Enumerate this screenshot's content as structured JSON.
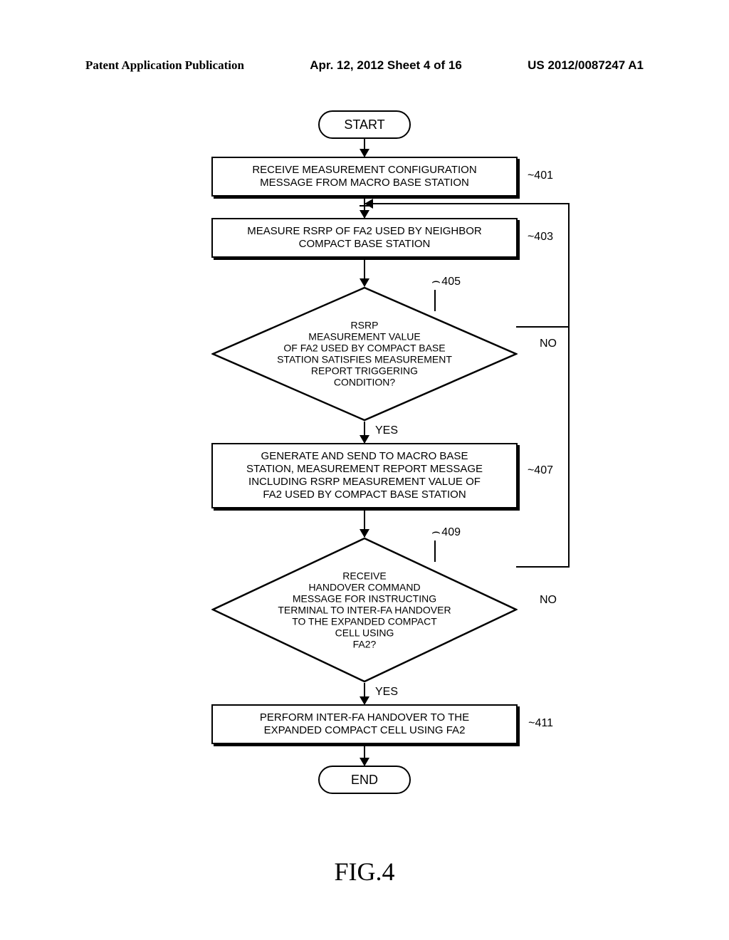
{
  "header": {
    "left": "Patent Application Publication",
    "center": "Apr. 12, 2012  Sheet 4 of 16",
    "right": "US 2012/0087247 A1"
  },
  "flowchart": {
    "start": "START",
    "step1": "RECEIVE MEASUREMENT CONFIGURATION\nMESSAGE FROM MACRO BASE STATION",
    "step1_label": "401",
    "step2": "MEASURE RSRP OF FA2 USED BY NEIGHBOR\nCOMPACT BASE STATION",
    "step2_label": "403",
    "decision1": "RSRP\nMEASUREMENT VALUE\nOF FA2 USED BY COMPACT BASE\nSTATION SATISFIES MEASUREMENT\nREPORT TRIGGERING\nCONDITION?",
    "decision1_label": "405",
    "step3": "GENERATE AND SEND TO MACRO BASE\nSTATION, MEASUREMENT REPORT MESSAGE\nINCLUDING RSRP MEASUREMENT VALUE OF\nFA2 USED BY COMPACT BASE STATION",
    "step3_label": "407",
    "decision2": "RECEIVE\nHANDOVER COMMAND\nMESSAGE FOR INSTRUCTING\nTERMINAL TO INTER-FA HANDOVER\nTO THE EXPANDED COMPACT\nCELL USING\nFA2?",
    "decision2_label": "409",
    "step4": "PERFORM INTER-FA HANDOVER TO THE\nEXPANDED COMPACT CELL USING FA2",
    "step4_label": "411",
    "end": "END",
    "yes": "YES",
    "no": "NO"
  },
  "figure": "FIG.4"
}
